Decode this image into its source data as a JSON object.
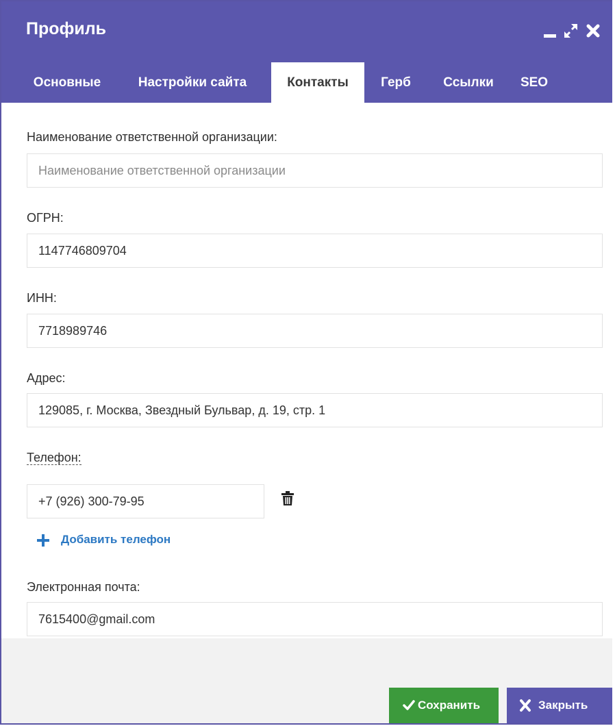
{
  "window": {
    "title": "Профиль"
  },
  "tabs": [
    {
      "label": "Основные"
    },
    {
      "label": "Настройки сайта"
    },
    {
      "label": "Контакты"
    },
    {
      "label": "Герб"
    },
    {
      "label": "Ссылки"
    },
    {
      "label": "SEO"
    }
  ],
  "active_tab": "Контакты",
  "form": {
    "org_name": {
      "label": "Наименование ответственной организации:",
      "value": "",
      "placeholder": "Наименование ответственной организации"
    },
    "ogrn": {
      "label": "ОГРН:",
      "value": "1147746809704"
    },
    "inn": {
      "label": "ИНН:",
      "value": "7718989746"
    },
    "address": {
      "label": "Адрес:",
      "value": "129085, г. Москва, Звездный Бульвар, д. 19, стр. 1"
    },
    "phone": {
      "label": "Телефон:",
      "value": "+7 (926) 300-79-95",
      "add_label": "Добавить телефон"
    },
    "email": {
      "label": "Электронная почта:",
      "value": "7615400@gmail.com"
    }
  },
  "footer": {
    "save_label": "Сохранить",
    "close_label": "Закрыть"
  },
  "colors": {
    "header": "#5b57ad",
    "save": "#3c9a3c",
    "link": "#2b78c3"
  }
}
